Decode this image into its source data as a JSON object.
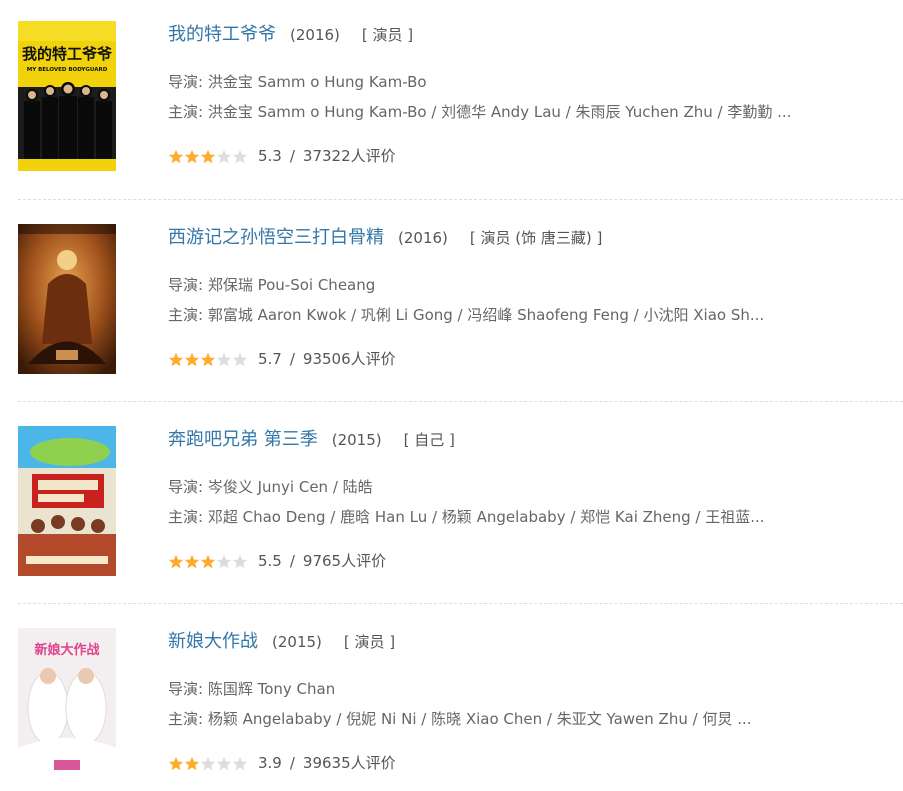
{
  "colors": {
    "title_link": "#3377aa",
    "star_filled": "#ffac2d",
    "star_empty": "#dddddd",
    "divider": "#dddddd"
  },
  "items": [
    {
      "title": "我的特工爷爷",
      "year": "(2016)",
      "role": "[ 演员 ]",
      "director": "导演: 洪金宝 Samm o Hung Kam-Bo",
      "cast": "主演: 洪金宝 Samm o Hung Kam-Bo / 刘德华 Andy Lau / 朱雨辰 Yuchen Zhu / 李勤勤 ...",
      "stars": 3,
      "score": "5.3",
      "ratings": "37322人评价",
      "poster_icon": "movie-poster-image",
      "poster_text": "我的特工爷爷",
      "poster_subtext": "MY BELOVED BODYGUARD"
    },
    {
      "title": "西游记之孙悟空三打白骨精",
      "year": "(2016)",
      "role": "[ 演员 (饰 唐三藏) ]",
      "director": "导演: 郑保瑞 Pou-Soi Cheang",
      "cast": "主演: 郭富城 Aaron Kwok / 巩俐 Li Gong / 冯绍峰 Shaofeng Feng / 小沈阳 Xiao Sh...",
      "stars": 3,
      "score": "5.7",
      "ratings": "93506人评价",
      "poster_icon": "movie-poster-image"
    },
    {
      "title": "奔跑吧兄弟 第三季",
      "year": "(2015)",
      "role": "[ 自己 ]",
      "director": "导演: 岑俊义 Junyi Cen / 陆皓",
      "cast": "主演: 邓超 Chao Deng / 鹿晗 Han Lu / 杨颖 Angelababy / 郑恺 Kai Zheng / 王祖蓝...",
      "stars": 3,
      "score": "5.5",
      "ratings": "9765人评价",
      "poster_icon": "movie-poster-image"
    },
    {
      "title": "新娘大作战",
      "year": "(2015)",
      "role": "[ 演员 ]",
      "director": "导演: 陈国辉 Tony Chan",
      "cast": "主演: 杨颖 Angelababy / 倪妮 Ni Ni / 陈晓 Xiao Chen / 朱亚文 Yawen Zhu / 何炅 ...",
      "stars": 2,
      "score": "3.9",
      "ratings": "39635人评价",
      "poster_icon": "movie-poster-image",
      "poster_text": "新娘大作战"
    }
  ],
  "separator": "/"
}
